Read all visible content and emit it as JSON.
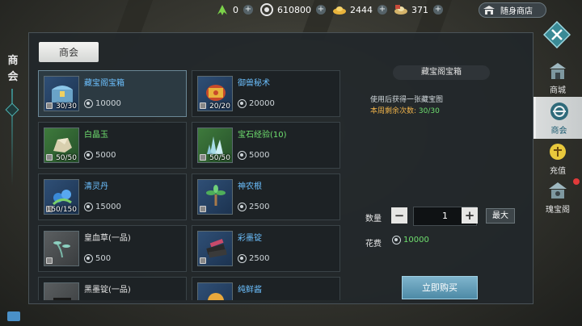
{
  "topbar": {
    "resources": [
      {
        "icon": "green-arrow-icon",
        "value": "0"
      },
      {
        "icon": "coin-icon",
        "value": "610800"
      },
      {
        "icon": "gold-ingot-icon",
        "value": "2444"
      },
      {
        "icon": "bound-ingot-icon",
        "value": "371"
      }
    ],
    "shop_label": "随身商店"
  },
  "left_title": "商会",
  "tab_label": "商会",
  "items": [
    {
      "name": "藏宝阁宝箱",
      "count": "30/30",
      "price": "10000",
      "frame": "blue",
      "name_color": "blue",
      "icon": "treasure-chest-icon",
      "locked": true,
      "selected": true
    },
    {
      "name": "御兽秘术",
      "count": "20/20",
      "price": "20000",
      "frame": "blue",
      "name_color": "blue",
      "icon": "beast-scroll-icon",
      "locked": true,
      "selected": false
    },
    {
      "name": "白晶玉",
      "count": "50/50",
      "price": "5000",
      "frame": "green",
      "name_color": "green",
      "icon": "white-jade-icon",
      "locked": true,
      "selected": false
    },
    {
      "name": "宝石经验(10)",
      "count": "50/50",
      "price": "5000",
      "frame": "green",
      "name_color": "green",
      "icon": "gem-crystal-icon",
      "locked": true,
      "selected": false
    },
    {
      "name": "清灵丹",
      "count": "150/150",
      "price": "15000",
      "frame": "blue",
      "name_color": "blue",
      "icon": "spirit-pill-icon",
      "locked": true,
      "selected": false
    },
    {
      "name": "神农根",
      "count": "",
      "price": "2500",
      "frame": "blue",
      "name_color": "blue",
      "icon": "herb-root-icon",
      "locked": true,
      "selected": false
    },
    {
      "name": "皇血草(一品)",
      "count": "",
      "price": "500",
      "frame": "gray",
      "name_color": "white",
      "icon": "blood-grass-icon",
      "locked": true,
      "selected": false
    },
    {
      "name": "彩墨锭",
      "count": "",
      "price": "2500",
      "frame": "blue",
      "name_color": "blue",
      "icon": "ink-stick-icon",
      "locked": true,
      "selected": false
    },
    {
      "name": "黑墨锭(一品)",
      "count": "",
      "price": "",
      "frame": "gray",
      "name_color": "white",
      "icon": "black-ink-icon",
      "locked": false,
      "selected": false
    },
    {
      "name": "纯鲜酱",
      "count": "",
      "price": "",
      "frame": "blue",
      "name_color": "blue",
      "icon": "sauce-icon",
      "locked": false,
      "selected": false
    }
  ],
  "detail": {
    "title": "藏宝阁宝箱",
    "description": "使用后获得一张藏宝图",
    "weekly_label": "本周剩余次数:",
    "weekly_value": "30/30",
    "quantity_label": "数量",
    "minus": "−",
    "quantity": "1",
    "plus": "+",
    "max_label": "最大",
    "cost_label": "花费",
    "cost_value": "10000",
    "buy_label": "立即购买"
  },
  "nav": [
    {
      "label": "商城",
      "icon": "mall-icon",
      "active": false
    },
    {
      "label": "商会",
      "icon": "guild-icon",
      "active": true
    },
    {
      "label": "充值",
      "icon": "recharge-icon",
      "active": false
    },
    {
      "label": "瑰宝阁",
      "icon": "treasure-pavilion-icon",
      "active": false
    }
  ],
  "colors": {
    "accent_blue": "#6cc0ff",
    "accent_green": "#6fe06f",
    "week_orange": "#f0b34a",
    "buy_button": "#5e9ab6"
  }
}
